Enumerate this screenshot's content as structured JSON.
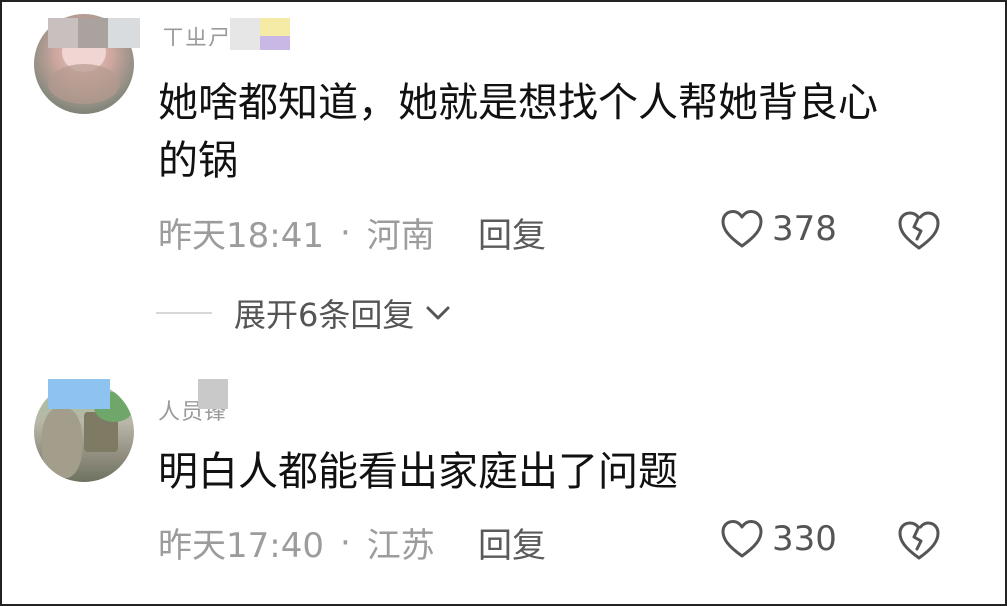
{
  "comments": [
    {
      "username": "ㄒㄓㄕ",
      "content_line1": "她啥都知道，她就是想找个人帮她背良心",
      "content_line2": "的锅",
      "time": "昨天18:41",
      "separator": "·",
      "location": "河南",
      "reply_label": "回复",
      "likes": "378"
    },
    {
      "username": "人员锋",
      "content_line1": "明白人都能看出家庭出了问题",
      "time": "昨天17:40",
      "separator": "·",
      "location": "江苏",
      "reply_label": "回复",
      "likes": "330"
    }
  ],
  "expand_replies": {
    "label": "展开6条回复"
  },
  "icons": {
    "like": "heart-icon",
    "dislike": "broken-heart-icon",
    "expand": "chevron-down-icon"
  },
  "colors": {
    "text_primary": "#111111",
    "text_secondary": "#9c9c9c",
    "icon": "#555555"
  }
}
